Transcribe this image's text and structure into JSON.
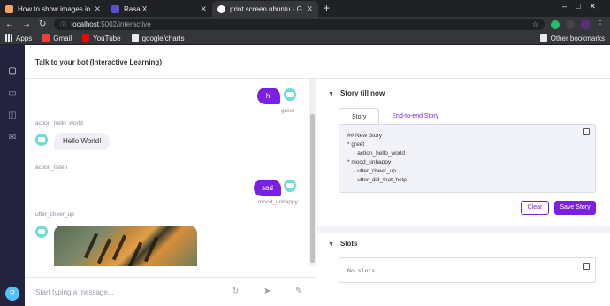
{
  "browser": {
    "tabs": [
      {
        "title": "How to show images in R",
        "favicon_color": "#f4a261",
        "active": false
      },
      {
        "title": "Rasa X",
        "favicon_color": "#5a4fcf",
        "active": false
      },
      {
        "title": "print screen ubuntu - Goo",
        "favicon_color": "#ffffff",
        "active": true
      }
    ],
    "new_tab": "+",
    "url_host": "localhost",
    "url_path": ":5002/interactive",
    "bookmarks": [
      {
        "label": "Apps",
        "icon": "apps-grid-icon",
        "color": "#e8eaed"
      },
      {
        "label": "Gmail",
        "icon": "gmail-icon",
        "color": "#ea4335"
      },
      {
        "label": "YouTube",
        "icon": "youtube-icon",
        "color": "#ff0000"
      },
      {
        "label": "google/charts",
        "icon": "folder-icon",
        "color": "#e8eaed"
      }
    ],
    "other_bookmarks": "Other bookmarks"
  },
  "app": {
    "header_title": "Talk to your bot (Interactive Learning)",
    "accent": "#7b1fe0",
    "sidebar_color": "#23233d",
    "user_initial": "R"
  },
  "chat": {
    "messages": [
      {
        "from": "user",
        "text": "hi",
        "intent": "greet"
      },
      {
        "from": "bot",
        "action": "action_hello_world",
        "text": "Hello World!"
      },
      {
        "from": "label",
        "action": "action_listen"
      },
      {
        "from": "user",
        "text": "sad",
        "intent": "mood_unhappy"
      },
      {
        "from": "bot",
        "action": "utter_cheer_up",
        "image": "tiger-image"
      }
    ],
    "input_placeholder": "Start typing a message..."
  },
  "story": {
    "section_title": "Story till now",
    "tabs": [
      "Story",
      "End-to-end Story"
    ],
    "lines": [
      "## New Story",
      "* greet",
      "    - action_hello_world",
      "* mood_unhappy",
      "    - utter_cheer_up",
      "    - utter_did_that_help"
    ],
    "clear_label": "Clear",
    "save_label": "Save Story"
  },
  "slots": {
    "section_title": "Slots",
    "content": "No slots"
  }
}
